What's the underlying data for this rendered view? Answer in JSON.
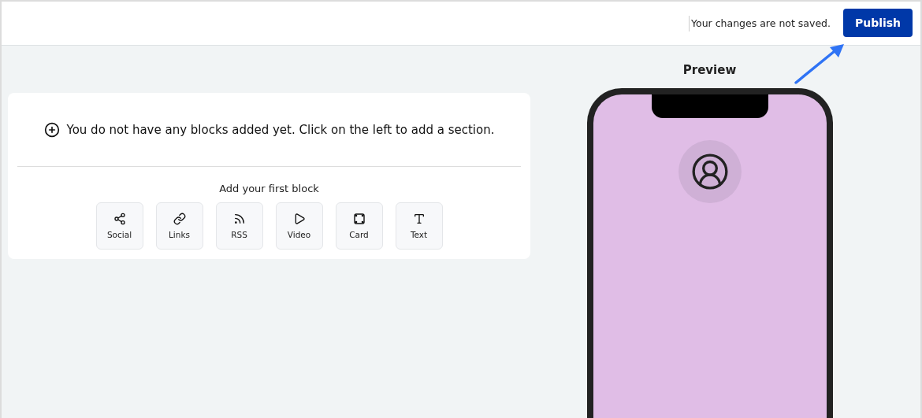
{
  "header": {
    "status": "Your changes are not saved.",
    "publish_button": "Publish"
  },
  "empty_state": {
    "message": "You do not have any blocks added yet. Click on the left to add a section.",
    "prompt": "Add your first block",
    "blocks": [
      {
        "kind": "social",
        "label": "Social"
      },
      {
        "kind": "links",
        "label": "Links"
      },
      {
        "kind": "rss",
        "label": "RSS"
      },
      {
        "kind": "video",
        "label": "Video"
      },
      {
        "kind": "card",
        "label": "Card"
      },
      {
        "kind": "text",
        "label": "Text"
      }
    ]
  },
  "preview": {
    "title": "Preview"
  }
}
